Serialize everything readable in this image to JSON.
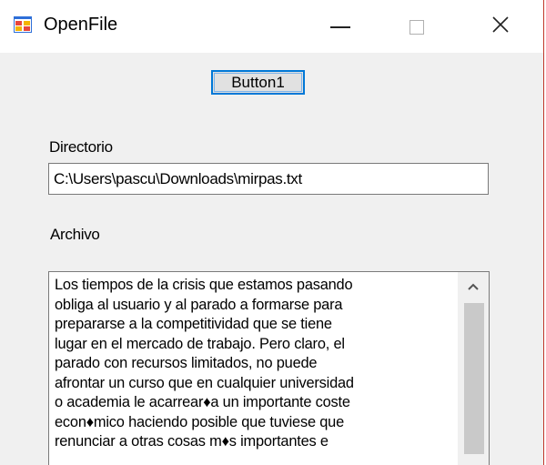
{
  "window": {
    "title": "OpenFile",
    "icon": "windows-form-icon"
  },
  "titlebar": {
    "minimize_icon": "minimize-icon",
    "maximize_icon": "maximize-icon",
    "close_icon": "close-icon"
  },
  "form": {
    "button1_label": "Button1",
    "directorio_label": "Directorio",
    "directorio_value": "C:\\Users\\pascu\\Downloads\\mirpas.txt",
    "archivo_label": "Archivo",
    "archivo_text": "Los tiempos de la crisis que estamos pasando\nobliga al usuario y al parado a formarse para\nprepararse a la competitividad que se tiene\nlugar en el mercado de trabajo. Pero claro, el\nparado con recursos limitados, no puede\nafrontar un curso que en cualquier universidad\no academia le acarrear♦a un importante coste\necon♦mico haciendo posible que tuviese que\nrenunciar a otras cosas m♦s importantes e"
  },
  "colors": {
    "window_bg": "#f0f0f0",
    "titlebar_bg": "#ffffff",
    "focus_border": "#0078d7",
    "window_edge": "#c0392b"
  }
}
